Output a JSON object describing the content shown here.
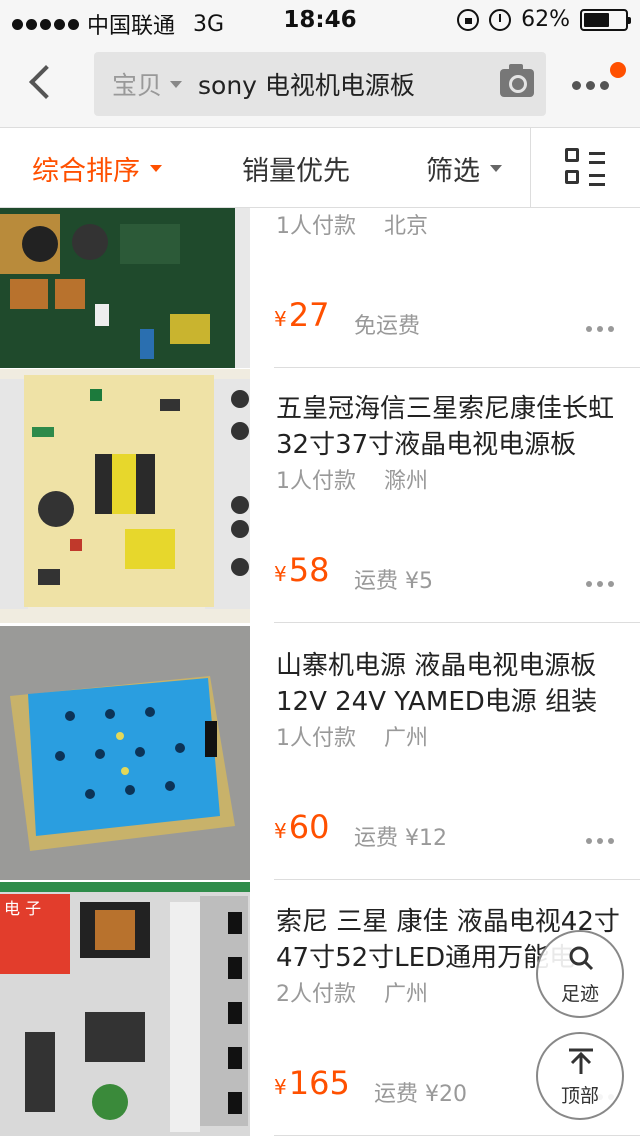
{
  "status_bar": {
    "carrier": "中国联通",
    "network": "3G",
    "time": "18:46",
    "battery_percent": "62%",
    "battery_level": 0.62
  },
  "nav": {
    "search_scope": "宝贝",
    "search_query": "sony 电视机电源板",
    "accent_color": "#ff5000"
  },
  "sort_bar": {
    "tabs": [
      {
        "label": "综合排序",
        "active": true
      },
      {
        "label": "销量优先",
        "active": false
      },
      {
        "label": "筛选",
        "active": false
      }
    ]
  },
  "products": [
    {
      "title": "",
      "buyers": "1人付款",
      "location": "北京",
      "currency": "¥",
      "price": "27",
      "shipping": "免运费"
    },
    {
      "title": "五皇冠海信三星索尼康佳长虹32寸37寸液晶电视电源板",
      "buyers": "1人付款",
      "location": "滁州",
      "currency": "¥",
      "price": "58",
      "shipping": "运费 ¥5"
    },
    {
      "title": "山寨机电源 液晶电视电源板 12V 24V YAMED电源 组装",
      "buyers": "1人付款",
      "location": "广州",
      "currency": "¥",
      "price": "60",
      "shipping": "运费 ¥12"
    },
    {
      "title": "索尼 三星 康佳 液晶电视42寸47寸52寸LED通用万能电",
      "buyers": "2人付款",
      "location": "广州",
      "currency": "¥",
      "price": "165",
      "shipping": "运费 ¥20"
    }
  ],
  "thumb_watermark": "电 子",
  "floating": {
    "footprint_label": "足迹",
    "top_label": "顶部"
  }
}
